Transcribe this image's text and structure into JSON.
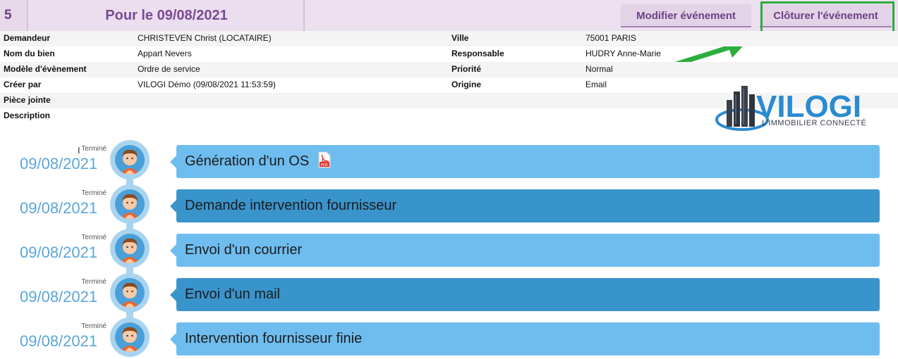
{
  "header": {
    "number": "5",
    "title": "Pour le 09/08/2021",
    "edit_button": "Modifier événement",
    "close_button": "Clôturer l'événement"
  },
  "info": {
    "left": [
      {
        "label": "Demandeur",
        "value": "CHRISTEVEN Christ (LOCATAIRE)"
      },
      {
        "label": "Nom du bien",
        "value": "Appart Nevers"
      },
      {
        "label": "Modèle d'évènement",
        "value": "Ordre de service"
      },
      {
        "label": "Créer par",
        "value": "VILOGI Démo (09/08/2021 11:53:59)"
      },
      {
        "label": "Pièce jointe",
        "value": ""
      },
      {
        "label": "Description",
        "value": ""
      }
    ],
    "right": [
      {
        "label": "Ville",
        "value": "75001 PARIS"
      },
      {
        "label": "Responsable",
        "value": "HUDRY Anne-Marie"
      },
      {
        "label": "Priorité",
        "value": "Normal"
      },
      {
        "label": "Origine",
        "value": "Email"
      }
    ]
  },
  "logo": {
    "name": "VILOGI",
    "tagline": "L'IMMOBILIER CONNECTÉ"
  },
  "timeline": [
    {
      "status": "Terminé",
      "date": "09/08/2021",
      "title": "Génération d'un OS",
      "has_pdf": true,
      "style": "light"
    },
    {
      "status": "Terminé",
      "date": "09/08/2021",
      "title": "Demande intervention fournisseur",
      "has_pdf": false,
      "style": "dark"
    },
    {
      "status": "Terminé",
      "date": "09/08/2021",
      "title": "Envoi d'un courrier",
      "has_pdf": false,
      "style": "light"
    },
    {
      "status": "Terminé",
      "date": "09/08/2021",
      "title": "Envoi d'un mail",
      "has_pdf": false,
      "style": "dark"
    },
    {
      "status": "Terminé",
      "date": "09/08/2021",
      "title": "Intervention fournisseur finie",
      "has_pdf": false,
      "style": "light"
    }
  ],
  "colors": {
    "header_bg": "#ece0ee",
    "accent_purple": "#6d3f86",
    "highlight_green": "#2aae3c",
    "card_light": "#6fbdef",
    "card_dark": "#3a94cc"
  }
}
